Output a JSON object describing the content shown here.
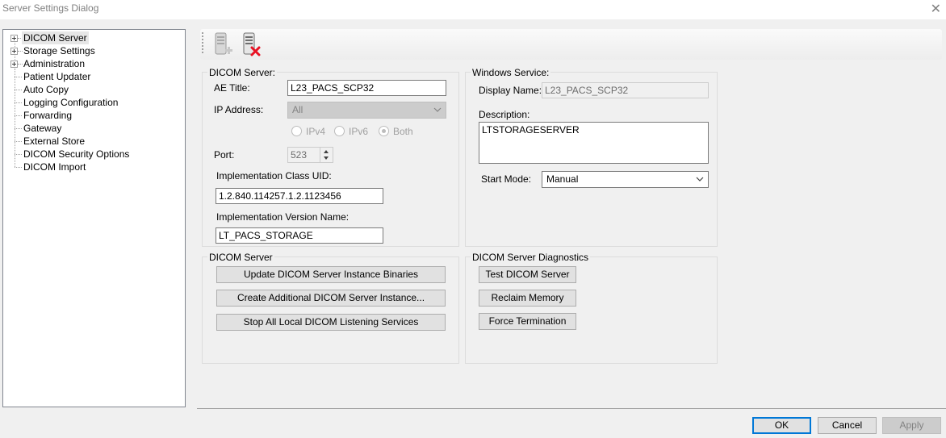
{
  "window": {
    "title": "Server Settings Dialog",
    "close_glyph": "✕"
  },
  "tree": {
    "items": [
      {
        "label": "DICOM Server",
        "expandable": true,
        "selected": true
      },
      {
        "label": "Storage Settings",
        "expandable": true
      },
      {
        "label": "Administration",
        "expandable": true
      },
      {
        "label": "Patient Updater"
      },
      {
        "label": "Auto Copy"
      },
      {
        "label": "Logging Configuration"
      },
      {
        "label": "Forwarding"
      },
      {
        "label": "Gateway"
      },
      {
        "label": "External Store"
      },
      {
        "label": "DICOM Security Options"
      },
      {
        "label": "DICOM Import"
      }
    ]
  },
  "toolbar": {
    "icons": [
      "server-add-icon",
      "server-delete-icon"
    ]
  },
  "dicom_server": {
    "group_label": "DICOM Server:",
    "ae_title_label": "AE Title:",
    "ae_title": "L23_PACS_SCP32",
    "ip_label": "IP Address:",
    "ip_value": "All",
    "radio_ipv4": "IPv4",
    "radio_ipv6": "IPv6",
    "radio_both": "Both",
    "port_label": "Port:",
    "port_value": "523",
    "impl_uid_label": "Implementation Class UID:",
    "impl_uid": "1.2.840.114257.1.2.1123456",
    "impl_version_label": "Implementation Version Name:",
    "impl_version": "LT_PACS_STORAGE"
  },
  "windows_service": {
    "group_label": "Windows Service:",
    "display_name_label": "Display Name:",
    "display_name": "L23_PACS_SCP32",
    "description_label": "Description:",
    "description": "LTSTORAGESERVER",
    "start_mode_label": "Start Mode:",
    "start_mode": "Manual"
  },
  "server_actions": {
    "group_label": "DICOM Server",
    "update_binaries": "Update DICOM Server Instance Binaries",
    "create_instance": "Create Additional DICOM Server Instance...",
    "stop_all": "Stop All Local DICOM Listening Services"
  },
  "diagnostics": {
    "group_label": "DICOM Server Diagnostics",
    "test": "Test DICOM Server",
    "reclaim": "Reclaim Memory",
    "force": "Force Termination"
  },
  "footer": {
    "ok": "OK",
    "cancel": "Cancel",
    "apply": "Apply"
  },
  "colors": {
    "focus_border": "#0078d7",
    "delete_icon": "#e81123"
  }
}
